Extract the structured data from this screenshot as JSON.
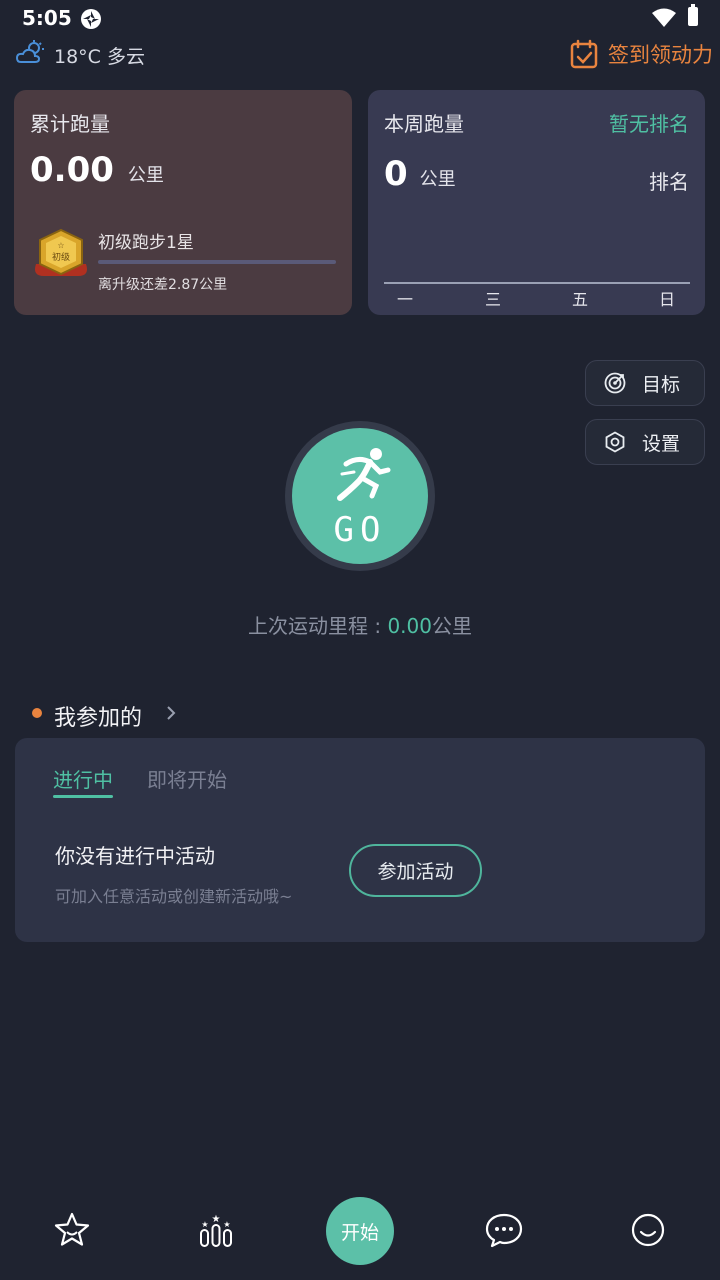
{
  "status_bar": {
    "time": "5:05"
  },
  "weather": {
    "temperature": "18°C",
    "condition": "多云",
    "text": "18°C 多云"
  },
  "checkin": {
    "label": "签到领动力"
  },
  "total_card": {
    "title": "累计跑量",
    "distance": "0.00",
    "unit": "公里",
    "level_name": "初级跑步1星",
    "level_progress_percent": 0,
    "remaining_text": "离升级还差2.87公里"
  },
  "week_card": {
    "title": "本周跑量",
    "rank_status": "暂无排名",
    "distance": "0",
    "unit": "公里",
    "rank_label": "排名",
    "days": [
      "一",
      "三",
      "五",
      "日"
    ]
  },
  "side_buttons": {
    "goal": "目标",
    "settings": "设置"
  },
  "go_button": {
    "label": "GO"
  },
  "last_run": {
    "prefix": "上次运动里程 : ",
    "value": "0.00",
    "unit": "公里"
  },
  "my_joined": {
    "title": "我参加的",
    "tabs": [
      "进行中",
      "即将开始"
    ],
    "empty_title": "你没有进行中活动",
    "empty_subtitle": "可加入任意活动或创建新活动哦~",
    "join_button": "参加活动"
  },
  "bottom_nav": {
    "items": [
      "star-icon",
      "ranking-icon",
      "开始",
      "chat-icon",
      "smile-icon"
    ],
    "start_label": "开始"
  },
  "colors": {
    "accent": "#5cc0a8",
    "orange": "#e9843f",
    "background": "#1f2330"
  }
}
